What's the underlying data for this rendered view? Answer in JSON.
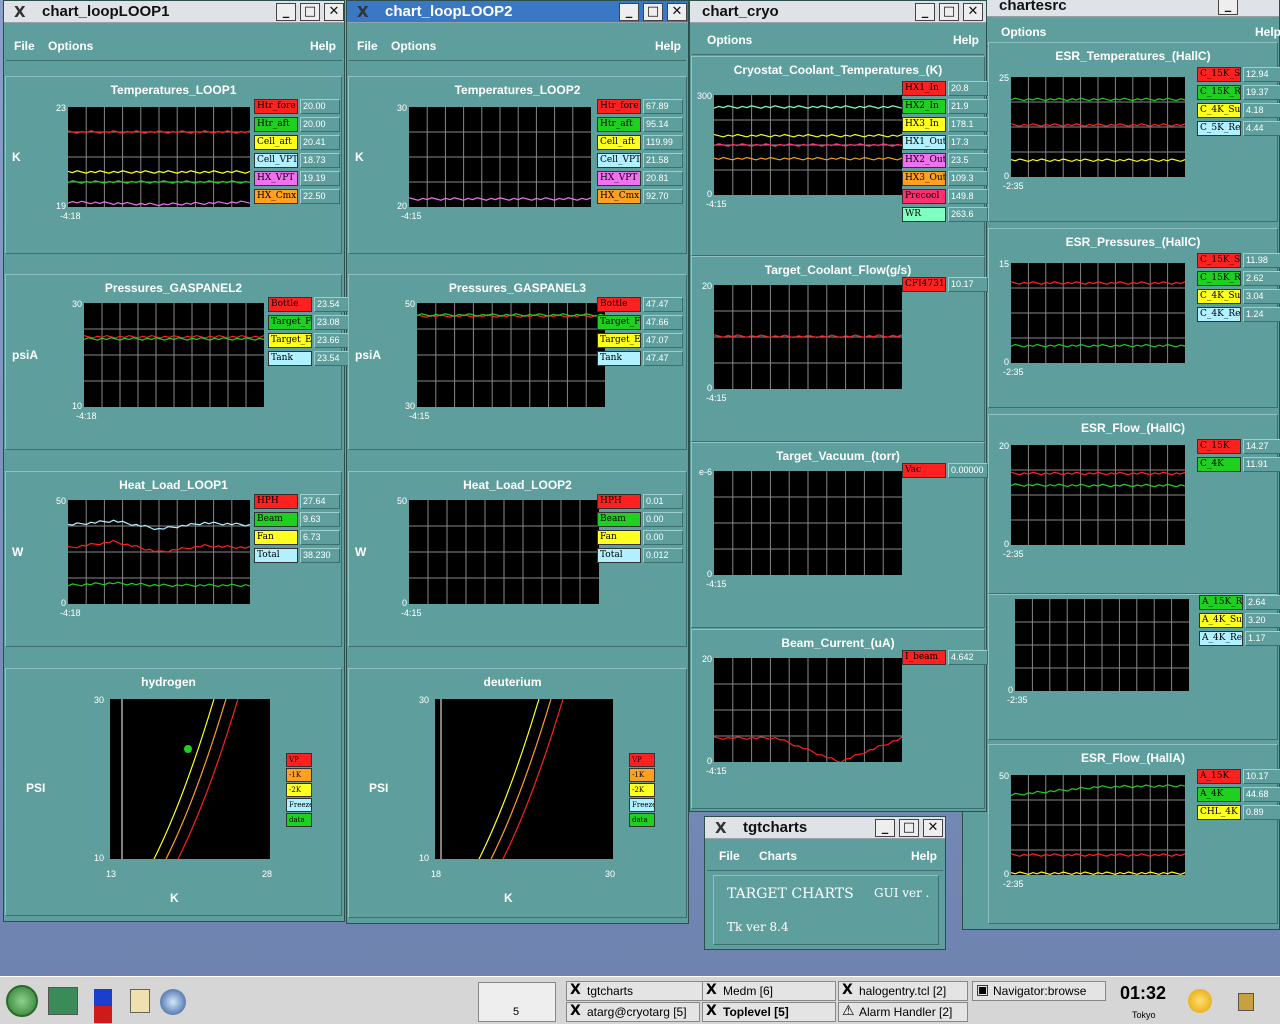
{
  "windows": {
    "loop1": {
      "title": "chart_loopLOOP1",
      "menu": [
        "File",
        "Options",
        "Help"
      ]
    },
    "loop2": {
      "title": "chart_loopLOOP2",
      "menu": [
        "File",
        "Options",
        "Help"
      ]
    },
    "cryo": {
      "title": "chart_cryo",
      "menu": [
        "Options",
        "Help"
      ]
    },
    "esr": {
      "title": "chartesrc",
      "menu": [
        "Options",
        "Help"
      ]
    },
    "tgt": {
      "title": "tgtcharts",
      "menu": [
        "File",
        "Charts",
        "Help"
      ],
      "heading": "TARGET CHARTS",
      "gui": "GUI ver .",
      "tk": "Tk ver 8.4"
    }
  },
  "panels": [
    {
      "id": "l1t",
      "title": "Temperatures_LOOP1",
      "unit": "K",
      "ymax": "23",
      "ymin": "19",
      "xlabel": "-4:18",
      "legend": [
        [
          "Htr_fore",
          "20.00",
          "#ff2020"
        ],
        [
          "Htr_aft",
          "20.00",
          "#20d020"
        ],
        [
          "Cell_aft",
          "20.41",
          "#ffff20"
        ],
        [
          "Cell_VPT",
          "18.73",
          "#b0f0ff"
        ],
        [
          "HX_VPT",
          "19.19",
          "#f070f0"
        ],
        [
          "HX_Cmx",
          "22.50",
          "#ffa020"
        ]
      ]
    },
    {
      "id": "l1p",
      "title": "Pressures_GASPANEL2",
      "unit": "psiA",
      "ymax": "30",
      "ymin": "10",
      "xlabel": "-4:18",
      "legend": [
        [
          "Bottle",
          "23.54",
          "#ff2020"
        ],
        [
          "Target_Fi",
          "23.08",
          "#20d020"
        ],
        [
          "Target_Ex",
          "23.66",
          "#ffff20"
        ],
        [
          "Tank",
          "23.54",
          "#b0f0ff"
        ]
      ]
    },
    {
      "id": "l1h",
      "title": "Heat_Load_LOOP1",
      "unit": "W",
      "ymax": "50",
      "ymin": "0",
      "xlabel": "-4:18",
      "legend": [
        [
          "HPH",
          "27.64",
          "#ff2020"
        ],
        [
          "Beam",
          "9.63",
          "#20d020"
        ],
        [
          "Fan",
          "6.73",
          "#ffff20"
        ],
        [
          "Total",
          "38.230",
          "#b0f0ff"
        ]
      ]
    },
    {
      "id": "l2t",
      "title": "Temperatures_LOOP2",
      "unit": "K",
      "ymax": "30",
      "ymin": "20",
      "xlabel": "-4:15",
      "legend": [
        [
          "Htr_fore",
          "67.89",
          "#ff2020"
        ],
        [
          "Htr_aft",
          "95.14",
          "#20d020"
        ],
        [
          "Cell_aft",
          "119.99",
          "#ffff20"
        ],
        [
          "Cell_VPT",
          "21.58",
          "#b0f0ff"
        ],
        [
          "HX_VPT",
          "20.81",
          "#f070f0"
        ],
        [
          "HX_Cmx",
          "92.70",
          "#ffa020"
        ]
      ]
    },
    {
      "id": "l2p",
      "title": "Pressures_GASPANEL3",
      "unit": "psiA",
      "ymax": "50",
      "ymin": "30",
      "xlabel": "-4:15",
      "legend": [
        [
          "Bottle",
          "47.47",
          "#ff2020"
        ],
        [
          "Target_Fi",
          "47.66",
          "#20d020"
        ],
        [
          "Target_Ex",
          "47.07",
          "#ffff20"
        ],
        [
          "Tank",
          "47.47",
          "#b0f0ff"
        ]
      ]
    },
    {
      "id": "l2h",
      "title": "Heat_Load_LOOP2",
      "unit": "W",
      "ymax": "50",
      "ymin": "0",
      "xlabel": "-4:15",
      "legend": [
        [
          "HPH",
          "0.01",
          "#ff2020"
        ],
        [
          "Beam",
          "0.00",
          "#20d020"
        ],
        [
          "Fan",
          "0.00",
          "#ffff20"
        ],
        [
          "Total",
          "0.012",
          "#b0f0ff"
        ]
      ]
    },
    {
      "id": "ct",
      "title": "Cryostat_Coolant_Temperatures_(K)",
      "unit": "",
      "ymax": "300",
      "ymin": "0",
      "xlabel": "-4:15",
      "legend": [
        [
          "HX1_In",
          "20.8",
          "#ff2020"
        ],
        [
          "HX2_In",
          "21.9",
          "#20d020"
        ],
        [
          "HX3_In",
          "178.1",
          "#ffff20"
        ],
        [
          "HX1_Out",
          "17.3",
          "#b0f0ff"
        ],
        [
          "HX2_Out",
          "23.5",
          "#f070f0"
        ],
        [
          "HX3_Out",
          "109.3",
          "#ffa020"
        ],
        [
          "Precool",
          "149.8",
          "#ff3070"
        ],
        [
          "WR",
          "263.6",
          "#80ffc0"
        ]
      ]
    },
    {
      "id": "cf",
      "title": "Target_Coolant_Flow(g/s)",
      "unit": "",
      "ymax": "20",
      "ymin": "0",
      "xlabel": "-4:15",
      "legend": [
        [
          "CFI4731A",
          "10.17",
          "#ff2020"
        ]
      ]
    },
    {
      "id": "cv",
      "title": "Target_Vacuum_(torr)",
      "unit": "",
      "ymax": "e-6",
      "ymin": "0",
      "xlabel": "-4:15",
      "legend": [
        [
          "Vac",
          "0.00000",
          "#ff2020"
        ]
      ]
    },
    {
      "id": "cb",
      "title": "Beam_Current_(uA)",
      "unit": "",
      "ymax": "20",
      "ymin": "0",
      "xlabel": "-4:15",
      "legend": [
        [
          "I_beam",
          "4.642",
          "#ff2020"
        ]
      ]
    },
    {
      "id": "et",
      "title": "ESR_Temperatures_(HallC)",
      "unit": "",
      "ymax": "25",
      "ymin": "0",
      "xlabel": "-2:35",
      "legend": [
        [
          "C_15K_Su",
          "12.94",
          "#ff2020"
        ],
        [
          "C_15K_R",
          "19.37",
          "#20d020"
        ],
        [
          "C_4K_Sup",
          "4.18",
          "#ffff20"
        ],
        [
          "C_5K_Re",
          "4.44",
          "#b0f0ff"
        ]
      ]
    },
    {
      "id": "ep",
      "title": "ESR_Pressures_(HallC)",
      "unit": "",
      "ymax": "15",
      "ymin": "0",
      "xlabel": "-2:35",
      "legend": [
        [
          "C_15K_Su",
          "11.98",
          "#ff2020"
        ],
        [
          "C_15K_R",
          "2.62",
          "#20d020"
        ],
        [
          "C_4K_Sup",
          "3.04",
          "#ffff20"
        ],
        [
          "C_4K_Re",
          "1.24",
          "#b0f0ff"
        ]
      ]
    },
    {
      "id": "ef",
      "title": "ESR_Flow_(HallC)",
      "unit": "",
      "ymax": "20",
      "ymin": "0",
      "xlabel": "-2:35",
      "legend": [
        [
          "C_15K",
          "14.27",
          "#ff2020"
        ],
        [
          "C_4K",
          "11.91",
          "#20d020"
        ]
      ]
    },
    {
      "id": "ea",
      "title": "",
      "unit": "",
      "ymax": "",
      "ymin": "0",
      "xlabel": "-2:35",
      "legend": [
        [
          "A_15K_R",
          "2.64",
          "#20d020"
        ],
        [
          "A_4K_Sup",
          "3.20",
          "#ffff20"
        ],
        [
          "A_4K_Re",
          "1.17",
          "#b0f0ff"
        ]
      ]
    },
    {
      "id": "efa",
      "title": "ESR_Flow_(HallA)",
      "unit": "",
      "ymax": "50",
      "ymin": "0",
      "xlabel": "-2:35",
      "legend": [
        [
          "A_15K",
          "10.17",
          "#ff2020"
        ],
        [
          "A_4K",
          "44.68",
          "#20d020"
        ],
        [
          "CHL_4K",
          "0.89",
          "#ffff20"
        ]
      ]
    }
  ],
  "phase": [
    {
      "id": "h",
      "title": "hydrogen",
      "unit": "PSI",
      "xlabel": "K",
      "ymax": "30",
      "ymin": "10",
      "xmin": "13",
      "xmax": "28"
    },
    {
      "id": "d",
      "title": "deuterium",
      "unit": "PSI",
      "xlabel": "K",
      "ymax": "30",
      "ymin": "10",
      "xmin": "18",
      "xmax": "30"
    }
  ],
  "phase_legend": [
    [
      "VP",
      "#ff2020"
    ],
    [
      "-1K",
      "#ffa020"
    ],
    [
      "-2K",
      "#ffff20"
    ],
    [
      "Freeze",
      "#b0f0ff"
    ],
    [
      "data",
      "#20d020"
    ]
  ],
  "taskbar": {
    "desk_num": "5",
    "tasks": [
      "tgtcharts",
      "Medm [6]",
      "halogentry.tcl [2]",
      "Navigator:browse",
      "atarg@cryotarg [5]",
      "Toplevel [5]",
      "Alarm Handler [2]"
    ],
    "clock": "01:32",
    "city": "Tokyo"
  },
  "chart_data": [
    {
      "type": "line",
      "title": "Temperatures_LOOP1",
      "ylabel": "K",
      "ylim": [
        19,
        23
      ],
      "series": [
        {
          "name": "Htr_fore",
          "values": [
            22.0,
            22.0,
            22.0
          ]
        },
        {
          "name": "Htr_aft",
          "values": [
            20.0,
            20.0,
            20.0
          ]
        },
        {
          "name": "Cell_aft",
          "values": [
            20.4,
            20.4,
            20.4
          ]
        },
        {
          "name": "HX_VPT",
          "values": [
            19.2,
            19.1,
            19.2
          ]
        }
      ]
    },
    {
      "type": "line",
      "title": "Pressures_GASPANEL2",
      "ylabel": "psiA",
      "ylim": [
        10,
        30
      ],
      "series": [
        {
          "name": "Bottle",
          "values": [
            23.5,
            23.5,
            23.5
          ]
        },
        {
          "name": "Target_Fi",
          "values": [
            23.1,
            23.1,
            23.1
          ]
        }
      ]
    },
    {
      "type": "line",
      "title": "Heat_Load_LOOP1",
      "ylabel": "W",
      "ylim": [
        0,
        50
      ],
      "series": [
        {
          "name": "HPH",
          "values": [
            27,
            30,
            25,
            28,
            27
          ]
        },
        {
          "name": "Beam",
          "values": [
            9,
            10,
            9,
            9,
            9
          ]
        },
        {
          "name": "Total",
          "values": [
            38,
            40,
            36,
            39,
            38
          ]
        }
      ]
    },
    {
      "type": "line",
      "title": "Temperatures_LOOP2",
      "ylabel": "K",
      "ylim": [
        20,
        30
      ],
      "series": [
        {
          "name": "HX_VPT",
          "values": [
            20.8,
            20.8,
            20.8
          ]
        }
      ]
    },
    {
      "type": "line",
      "title": "Pressures_GASPANEL3",
      "ylabel": "psiA",
      "ylim": [
        30,
        50
      ],
      "series": [
        {
          "name": "Bottle",
          "values": [
            47.5,
            47.5,
            47.5
          ]
        },
        {
          "name": "Target_Fi",
          "values": [
            47.7,
            47.7,
            47.7
          ]
        }
      ]
    },
    {
      "type": "line",
      "title": "Cryostat_Coolant_Temperatures_(K)",
      "ylim": [
        0,
        300
      ],
      "series": [
        {
          "name": "HX3_In",
          "values": [
            178,
            178,
            178
          ]
        },
        {
          "name": "Precool",
          "values": [
            150,
            150,
            150
          ]
        },
        {
          "name": "HX3_Out",
          "values": [
            109,
            109,
            109
          ]
        },
        {
          "name": "WR",
          "values": [
            264,
            264,
            264
          ]
        }
      ]
    },
    {
      "type": "line",
      "title": "Target_Coolant_Flow(g/s)",
      "ylim": [
        0,
        20
      ],
      "series": [
        {
          "name": "CFI4731A",
          "values": [
            10.2,
            10.1,
            10.2
          ]
        }
      ]
    },
    {
      "type": "line",
      "title": "Beam_Current_(uA)",
      "ylim": [
        0,
        20
      ],
      "series": [
        {
          "name": "I_beam",
          "values": [
            4.6,
            4.6,
            0,
            4.6
          ]
        }
      ]
    },
    {
      "type": "line",
      "title": "ESR_Temperatures_(HallC)",
      "ylim": [
        0,
        25
      ],
      "series": [
        {
          "name": "C_15K_Su",
          "values": [
            13,
            13,
            13
          ]
        },
        {
          "name": "C_15K_R",
          "values": [
            19.4,
            19.4,
            19.4
          ]
        },
        {
          "name": "C_4K_Sup",
          "values": [
            4.2,
            4.2,
            4.2
          ]
        }
      ]
    },
    {
      "type": "line",
      "title": "ESR_Pressures_(HallC)",
      "ylim": [
        0,
        15
      ],
      "series": [
        {
          "name": "C_15K_Su",
          "values": [
            12,
            12,
            12
          ]
        },
        {
          "name": "C_15K_R",
          "values": [
            2.6,
            2.6,
            2.6
          ]
        }
      ]
    },
    {
      "type": "line",
      "title": "ESR_Flow_(HallC)",
      "ylim": [
        0,
        20
      ],
      "series": [
        {
          "name": "C_15K",
          "values": [
            14.3,
            14.3,
            14.3
          ]
        },
        {
          "name": "C_4K",
          "values": [
            12,
            11.9,
            11.9
          ]
        }
      ]
    },
    {
      "type": "line",
      "title": "ESR_Flow_(HallA)",
      "ylim": [
        0,
        50
      ],
      "series": [
        {
          "name": "A_15K",
          "values": [
            10,
            10,
            10
          ]
        },
        {
          "name": "A_4K",
          "values": [
            40,
            44,
            44.7
          ]
        },
        {
          "name": "CHL_4K",
          "values": [
            0.9,
            0.9,
            0.9
          ]
        }
      ]
    }
  ]
}
